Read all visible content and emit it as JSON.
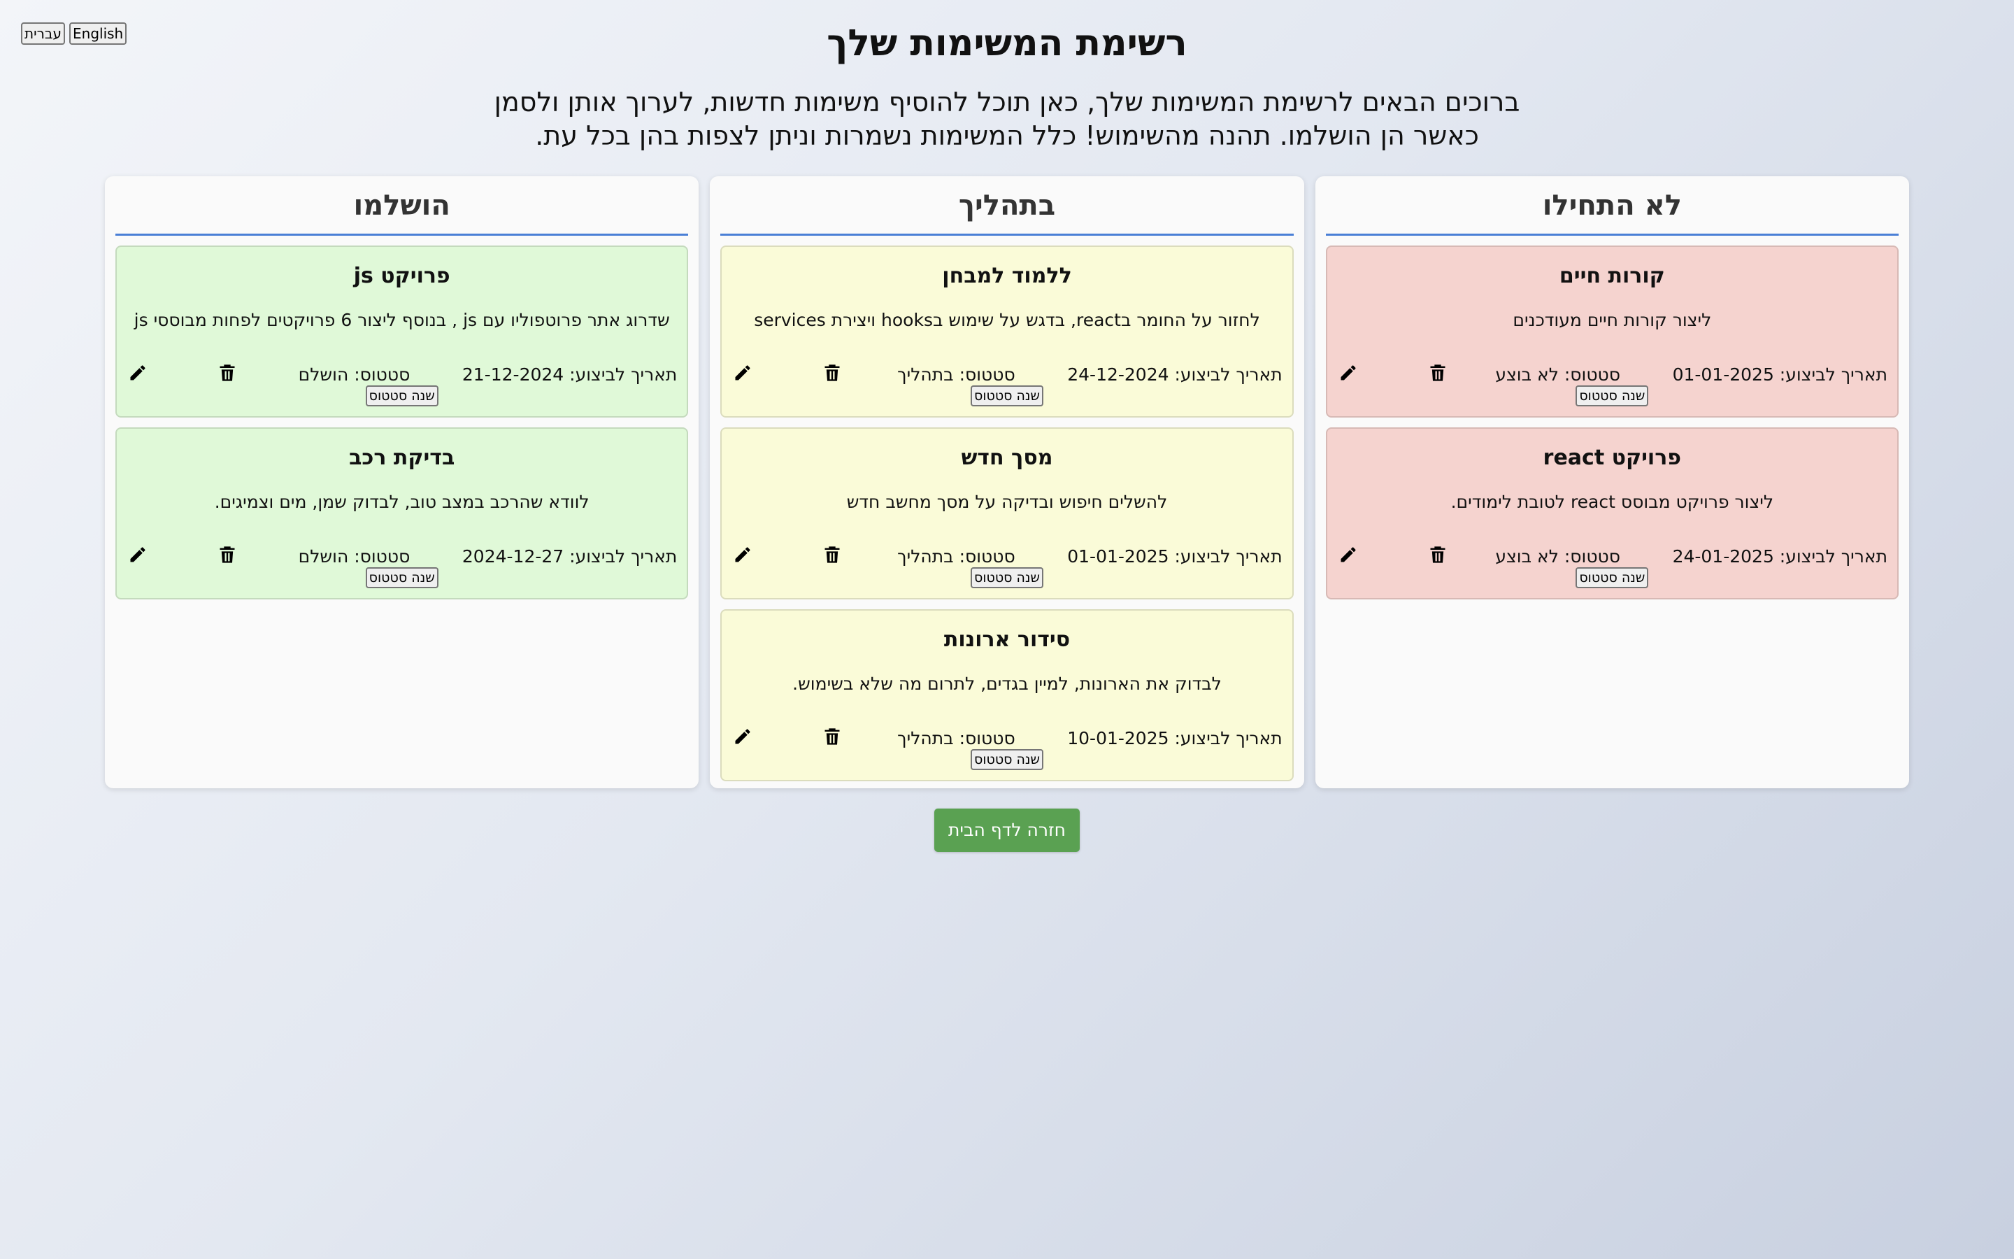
{
  "lang": {
    "hebrew_label": "עברית",
    "english_label": "English"
  },
  "header": {
    "title": "רשימת המשימות שלך",
    "intro_line1": "ברוכים הבאים לרשימת המשימות שלך, כאן תוכל להוסיף משימות חדשות, לערוך אותן ולסמן",
    "intro_line2": "כאשר הן הושלמו. תהנה מהשימוש! כלל המשימות נשמרות וניתן לצפות בהן בכל עת."
  },
  "colors": {
    "not_started_bg": "#f5d3cf",
    "in_progress_bg": "#fafbd8",
    "done_bg": "#e0f9d8",
    "column_rule": "#4a7fd6",
    "home_button": "#5aa152"
  },
  "columns": [
    {
      "title": "לא התחילו",
      "tasks": [
        {
          "title": "קורות חיים",
          "description": "ליצור קורות חיים מעודכנים",
          "due": "תאריך לביצוע: 01-01-2025",
          "status": "סטטוס: לא בוצע",
          "change_status_label": "שנה סטטוס"
        },
        {
          "title": "פרויקט react",
          "description": "ליצור פרויקט מבוסס react לטובת לימודים.",
          "due": "תאריך לביצוע: 24-01-2025",
          "status": "סטטוס: לא בוצע",
          "change_status_label": "שנה סטטוס"
        }
      ]
    },
    {
      "title": "בתהליך",
      "tasks": [
        {
          "title": "ללמוד למבחן",
          "description": "לחזור על החומר בreact, בדגש על שימוש בhooks ויצירת services",
          "due": "תאריך לביצוע: 24-12-2024",
          "status": "סטטוס: בתהליך",
          "change_status_label": "שנה סטטוס"
        },
        {
          "title": "מסך חדש",
          "description": "להשלים חיפוש ובדיקה על מסך מחשב חדש",
          "due": "תאריך לביצוע: 01-01-2025",
          "status": "סטטוס: בתהליך",
          "change_status_label": "שנה סטטוס"
        },
        {
          "title": "סידור ארונות",
          "description": "לבדוק את הארונות, למיין בגדים, לתרום מה שלא בשימוש.",
          "due": "תאריך לביצוע: 10-01-2025",
          "status": "סטטוס: בתהליך",
          "change_status_label": "שנה סטטוס"
        }
      ]
    },
    {
      "title": "הושלמו",
      "tasks": [
        {
          "title": "פרויקט js",
          "description": "שדרוג אתר פרוטפוליו עם js , בנוסף ליצור 6 פרויקטים לפחות מבוססי js",
          "due": "תאריך לביצוע: 21-12-2024",
          "status": "סטטוס: הושלם",
          "change_status_label": "שנה סטטוס"
        },
        {
          "title": "בדיקת רכב",
          "description": "לוודא שהרכב במצב טוב, לבדוק שמן, מים וצמיגים.",
          "due": "תאריך לביצוע: 2024-12-27",
          "status": "סטטוס: הושלם",
          "change_status_label": "שנה סטטוס"
        }
      ]
    }
  ],
  "footer": {
    "home_label": "חזרה לדף הבית"
  }
}
